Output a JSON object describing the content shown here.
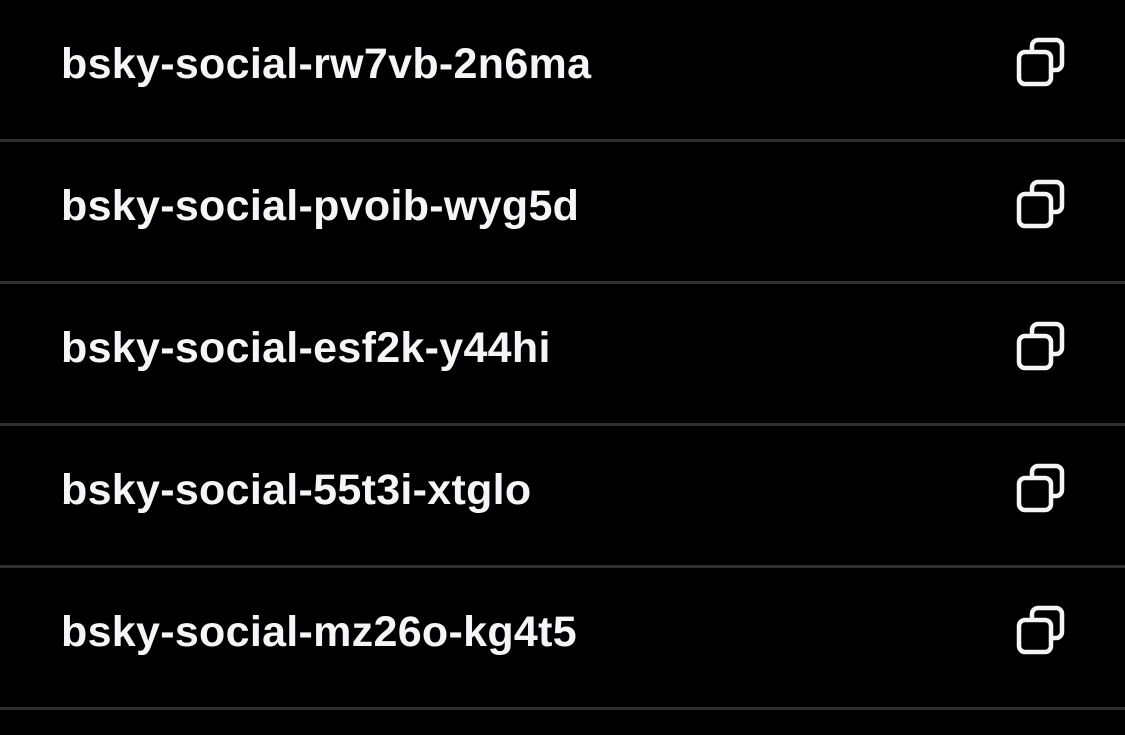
{
  "app_codes": {
    "items": [
      {
        "code": "bsky-social-rw7vb-2n6ma",
        "action_icon": "copy-icon"
      },
      {
        "code": "bsky-social-pvoib-wyg5d",
        "action_icon": "copy-icon"
      },
      {
        "code": "bsky-social-esf2k-y44hi",
        "action_icon": "copy-icon"
      },
      {
        "code": "bsky-social-55t3i-xtglo",
        "action_icon": "copy-icon"
      },
      {
        "code": "bsky-social-mz26o-kg4t5",
        "action_icon": "copy-icon"
      }
    ]
  },
  "colors": {
    "background": "#000000",
    "text": "#f5f5f7",
    "divider": "#2e2e34",
    "icon": "#f5f5f7"
  }
}
